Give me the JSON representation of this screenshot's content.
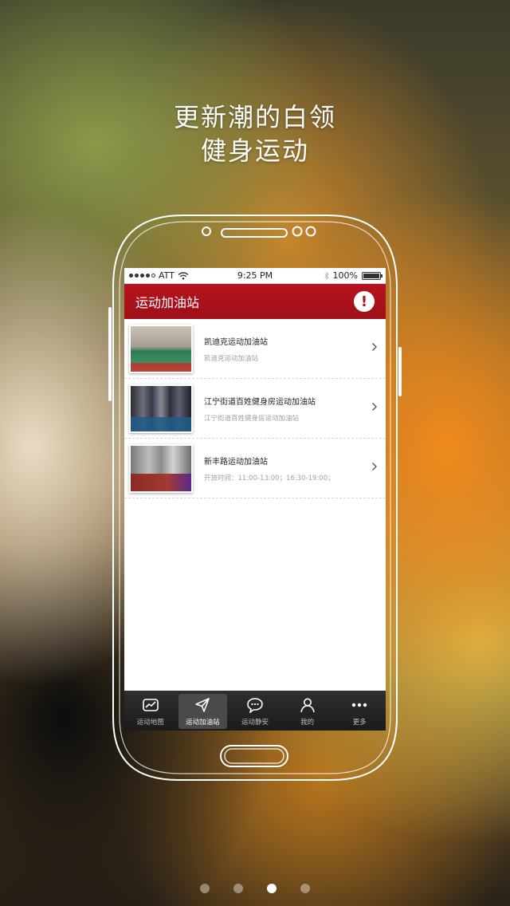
{
  "headline": {
    "line1": "更新潮的白领",
    "line2": "健身运动"
  },
  "statusbar": {
    "carrier": "ATT",
    "time": "9:25 PM",
    "battery": "100%"
  },
  "navbar": {
    "title": "运动加油站",
    "alert_glyph": "!"
  },
  "list": [
    {
      "title": "凯迪克运动加油站",
      "subtitle": "凯迪克运动加油站"
    },
    {
      "title": "江宁街道百姓健身房运动加油站",
      "subtitle": "江宁街道百姓健身房运动加油站"
    },
    {
      "title": "新丰路运动加油站",
      "subtitle": "开放时间：11:00-13:00；16:30-19:00；"
    }
  ],
  "tabs": [
    {
      "label": "运动地图",
      "icon": "map-chart-icon"
    },
    {
      "label": "运动加油站",
      "icon": "send-arrow-icon",
      "active": true
    },
    {
      "label": "运动静安",
      "icon": "chat-bubble-icon"
    },
    {
      "label": "我的",
      "icon": "person-icon"
    },
    {
      "label": "更多",
      "icon": "more-dots-icon"
    }
  ],
  "pager": {
    "total": 4,
    "current": 3
  }
}
